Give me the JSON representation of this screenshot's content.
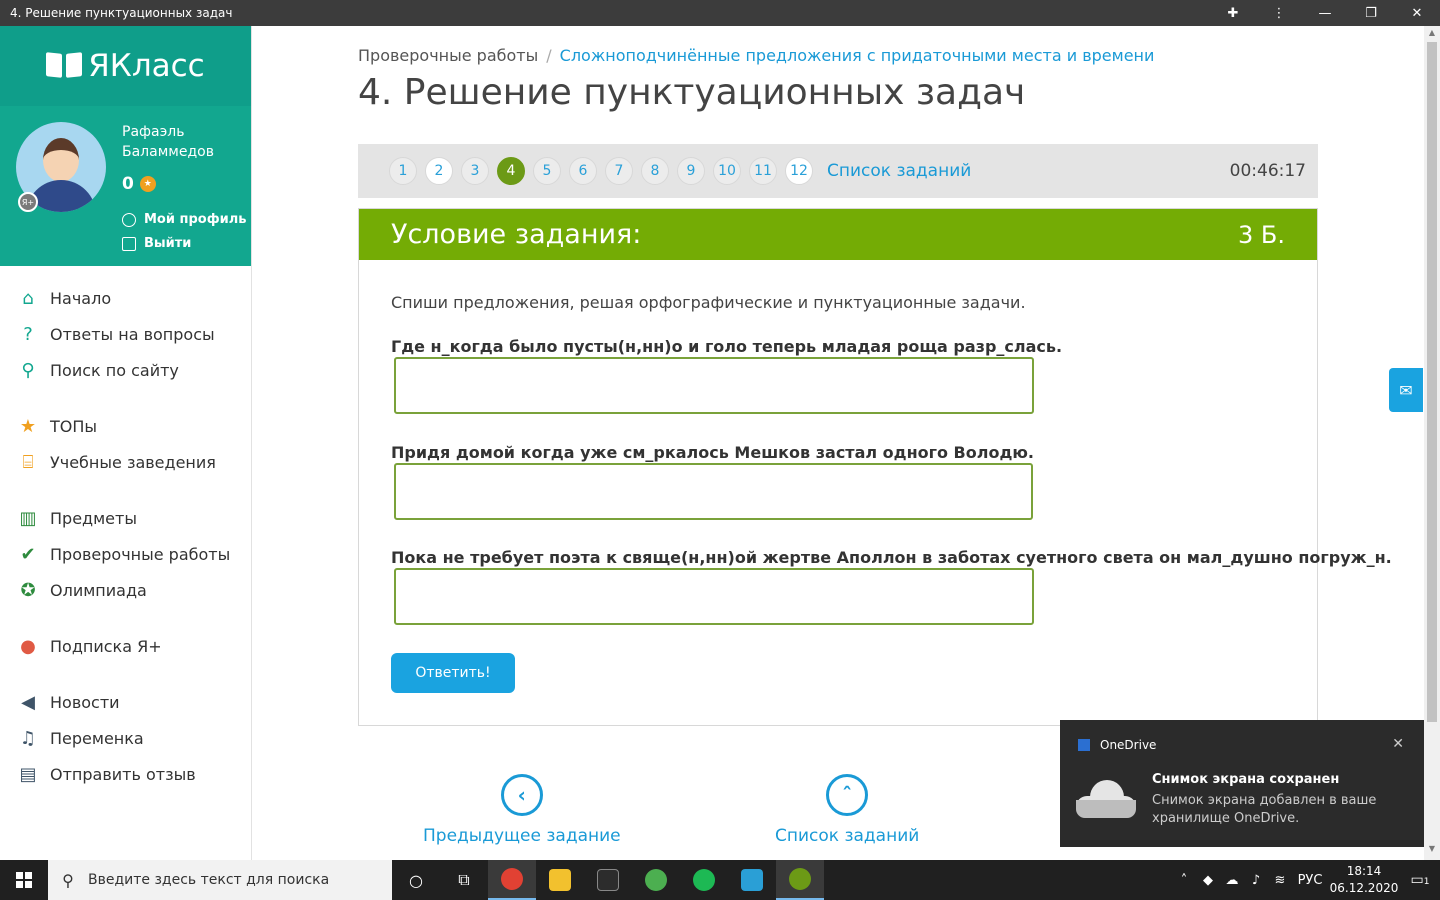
{
  "window": {
    "title": "4. Решение пунктуационных задач"
  },
  "logo": {
    "text": "ЯКласс"
  },
  "user": {
    "name": "Рафаэль Баламмедов",
    "points": "0",
    "badge": "Я+",
    "profile_link": "Мой профиль",
    "logout_link": "Выйти"
  },
  "nav": {
    "groups": [
      [
        {
          "label": "Начало",
          "icon": "home-icon"
        },
        {
          "label": "Ответы на вопросы",
          "icon": "question-icon"
        },
        {
          "label": "Поиск по сайту",
          "icon": "search-icon"
        }
      ],
      [
        {
          "label": "ТОПы",
          "icon": "star-icon"
        },
        {
          "label": "Учебные заведения",
          "icon": "institution-icon"
        }
      ],
      [
        {
          "label": "Предметы",
          "icon": "books-icon"
        },
        {
          "label": "Проверочные работы",
          "icon": "check-circle-icon"
        },
        {
          "label": "Олимпиада",
          "icon": "medal-icon"
        }
      ],
      [
        {
          "label": "Подписка Я+",
          "icon": "subscription-icon"
        }
      ],
      [
        {
          "label": "Новости",
          "icon": "megaphone-icon"
        },
        {
          "label": "Переменка",
          "icon": "bell-icon"
        },
        {
          "label": "Отправить отзыв",
          "icon": "feedback-icon"
        }
      ]
    ]
  },
  "breadcrumb": {
    "root": "Проверочные работы",
    "separator": "/",
    "current": "Сложноподчинённые предложения с придаточными места и времени"
  },
  "page": {
    "title": "4. Решение пунктуационных задач"
  },
  "tasks": {
    "numbers": [
      "1",
      "2",
      "3",
      "4",
      "5",
      "6",
      "7",
      "8",
      "9",
      "10",
      "11",
      "12"
    ],
    "active": "4",
    "list_link": "Список заданий",
    "timer": "00:46:17"
  },
  "task": {
    "header": "Условие задания:",
    "points": "3 Б.",
    "instruction": "Спиши предложения, решая орфографические и пунктуационные задачи.",
    "questions": [
      "Где н_когда было пусты(н,нн)о и голо теперь младая роща разр_слась.",
      "Придя домой когда уже см_ркалось Мешков застал одного Володю.",
      "Пока не требует поэта к свяще(н,нн)ой жертве Аполлон в заботах суетного света он мал_душно погруж_н."
    ],
    "answer_button": "Ответить!"
  },
  "bottom_nav": {
    "prev": "Предыдущее задание",
    "list": "Список заданий"
  },
  "toast": {
    "app": "OneDrive",
    "title": "Снимок экрана сохранен",
    "body": "Снимок экрана добавлен в ваше хранилище OneDrive."
  },
  "taskbar": {
    "search_placeholder": "Введите здесь текст для поиска",
    "language": "РУС",
    "time": "18:14",
    "date": "06.12.2020",
    "notifications": "1"
  },
  "colors": {
    "accent_teal": "#12a78f",
    "task_green": "#74ac05",
    "link_blue": "#1a9ad6",
    "button_blue": "#1aa3e0"
  }
}
